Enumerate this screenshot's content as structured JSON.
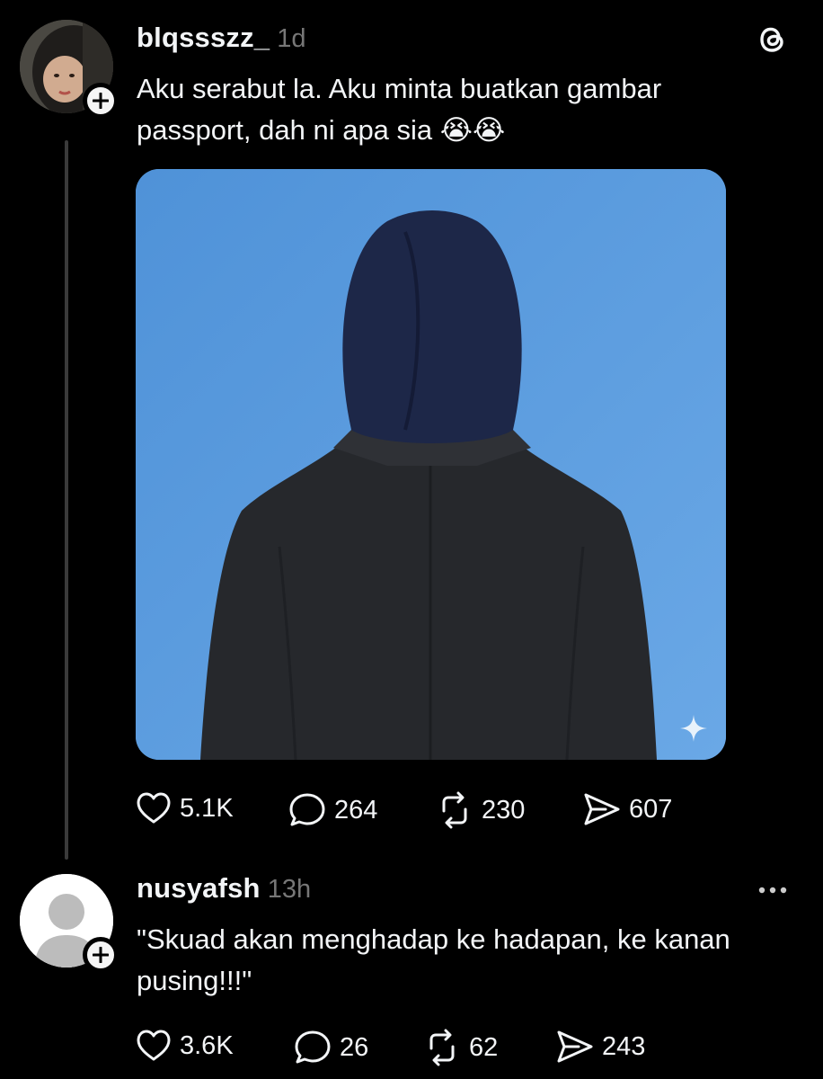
{
  "post": {
    "username": "blqssszz_",
    "time": "1d",
    "text": "Aku serabut la. Aku minta buatkan gambar passport, dah ni apa sia 😭😭",
    "stats": {
      "likes": "5.1K",
      "comments": "264",
      "reposts": "230",
      "shares": "607"
    },
    "image_icon": "sparkle-icon"
  },
  "reply": {
    "username": "nusyafsh",
    "time": "13h",
    "text": "\"Skuad akan menghadap ke hadapan, ke kanan pusing!!!\"",
    "stats": {
      "likes": "3.6K",
      "comments": "26",
      "reposts": "62",
      "shares": "243"
    }
  },
  "icons": {
    "app_logo": "threads-logo-icon",
    "follow": "plus-icon",
    "like": "heart-icon",
    "comment": "comment-bubble-icon",
    "repost": "repost-icon",
    "share": "send-icon",
    "more": "more-dots-icon"
  },
  "colors": {
    "background": "#000000",
    "text": "#f3f5f7",
    "muted": "#777777",
    "image_bg": "#5b9ee0"
  }
}
